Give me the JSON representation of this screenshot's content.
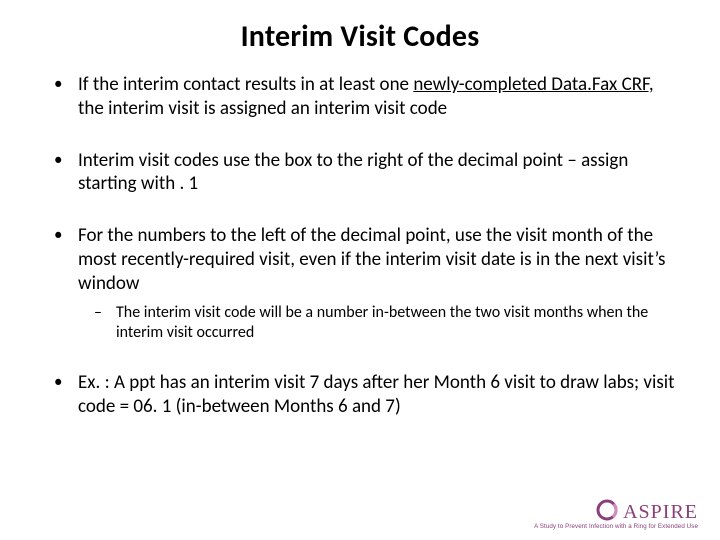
{
  "title": "Interim Visit Codes",
  "bullets": {
    "b1_pre": "If the interim contact results in at least one ",
    "b1_u": "newly-completed Data.Fax CRF,",
    "b1_post": " the interim visit is assigned an interim visit code",
    "b2": "Interim visit codes use the box to the right of the decimal point – assign starting with . 1",
    "b3": "For the numbers to the left of the decimal point, use the visit month of the most recently-required visit, even if the interim visit date is in the next visit’s window",
    "b3_sub": "The interim visit code will be a number in-between the two visit months when the interim visit occurred",
    "b4": "Ex. : A ppt has an interim visit 7 days after her Month 6 visit to draw labs; visit code = 06. 1 (in-between Months 6 and 7)"
  },
  "logo": {
    "text": "ASPIRE",
    "tagline": "A Study to Prevent Infection with a Ring for Extended Use"
  }
}
